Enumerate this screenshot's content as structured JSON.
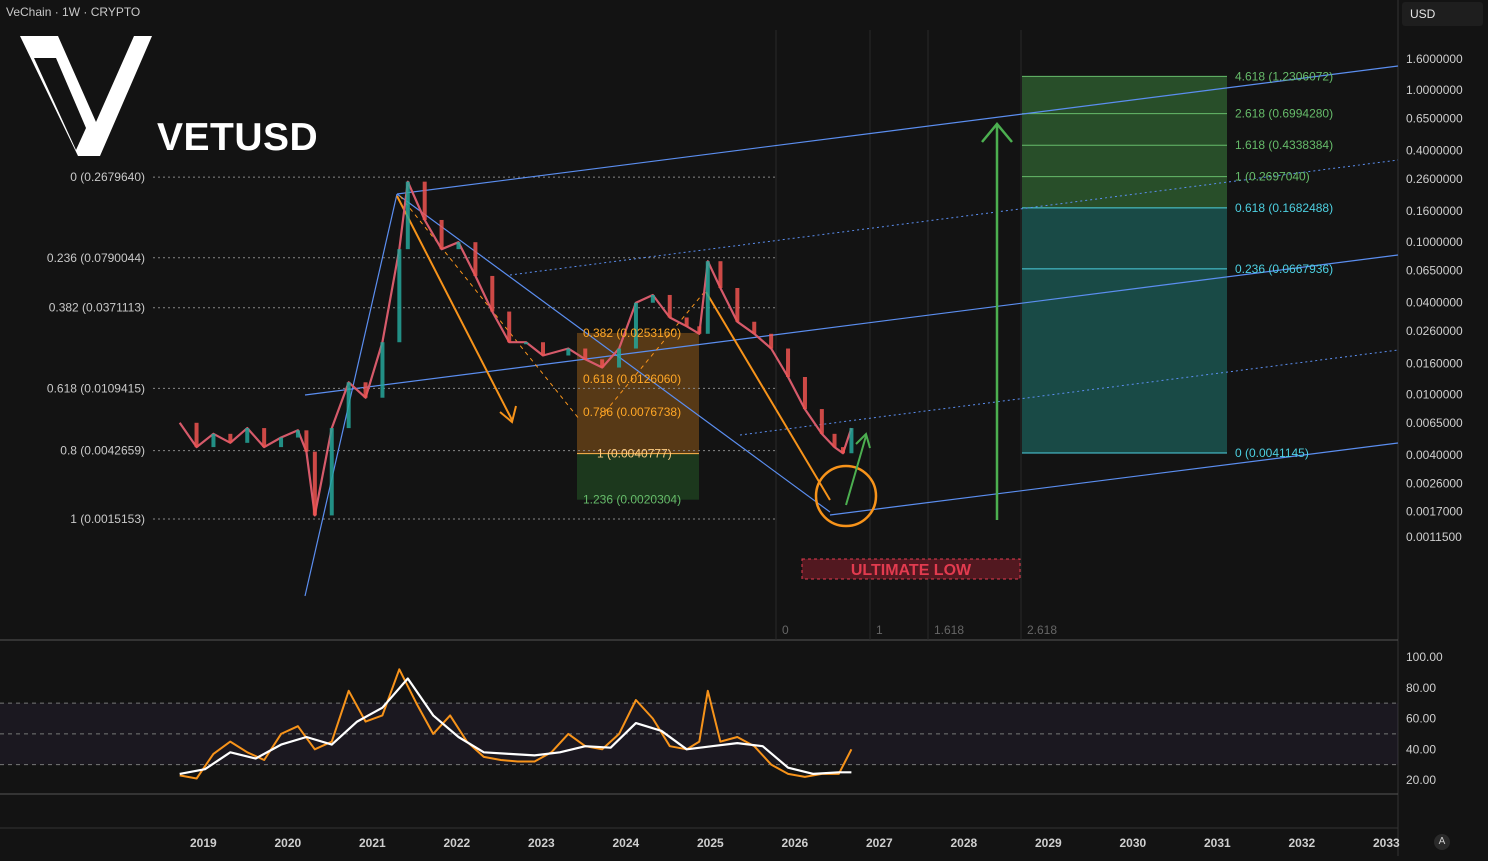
{
  "header": {
    "title": "VeChain · 1W · CRYPTO",
    "currency": "USD",
    "ticker": "VETUSD",
    "logo": "vechain-logo",
    "auto_button": "A"
  },
  "colors": {
    "background": "#131313",
    "bull": "#26a69a",
    "bear": "#ef5350",
    "orange": "#f7931a",
    "blue": "#5b8ef0",
    "green": "#4caf50",
    "cyan": "#4dd0e1",
    "red": "#e23b4f"
  },
  "price_axis": [
    "1.6000000",
    "1.0000000",
    "0.6500000",
    "0.4000000",
    "0.2600000",
    "0.1600000",
    "0.1000000",
    "0.0650000",
    "0.0400000",
    "0.0260000",
    "0.0160000",
    "0.0100000",
    "0.0065000",
    "0.0040000",
    "0.0026000",
    "0.0017000",
    "0.0011500"
  ],
  "rsi_axis": [
    "100.00",
    "80.00",
    "60.00",
    "40.00",
    "20.00"
  ],
  "time_axis": [
    "2019",
    "2020",
    "2021",
    "2022",
    "2023",
    "2024",
    "2025",
    "2026",
    "2027",
    "2028",
    "2029",
    "2030",
    "2031",
    "2032",
    "2033"
  ],
  "fib_retracement": [
    "0 (0.2679640)",
    "0.236 (0.0790044)",
    "0.382 (0.0371113)",
    "0.618 (0.0109415)",
    "0.8 (0.0042659)",
    "1 (0.0015153)"
  ],
  "fib_box_orange": [
    "0.382 (0.0253160)",
    "0.618 (0.0126060)",
    "0.786 (0.0076738)",
    "1 (0.0040777)",
    "1.236 (0.0020304)"
  ],
  "fib_extension": [
    "4.618 (1.2306072)",
    "2.618 (0.6994280)",
    "1.618 (0.4338384)",
    "1 (0.2697040)",
    "0.618 (0.1682488)",
    "0.236 (0.0667936)",
    "0 (0.0041145)"
  ],
  "time_fib": [
    "0",
    "1",
    "1.618",
    "2.618"
  ],
  "annotation": "ULTIMATE LOW",
  "chart_data": {
    "type": "line",
    "title": "VETUSD",
    "y_scale": "log",
    "ylim": [
      0.00105,
      2.0
    ],
    "x_range": [
      2018.55,
      2033.25
    ],
    "series": [
      {
        "x": [
          2018.7,
          2018.9,
          2019.1,
          2019.3,
          2019.5,
          2019.7,
          2019.9,
          2020.1,
          2020.2,
          2020.3,
          2020.5,
          2020.7,
          2020.9,
          2021.1,
          2021.3,
          2021.4,
          2021.6,
          2021.8,
          2022.0,
          2022.2,
          2022.4,
          2022.6,
          2022.8,
          2023.0,
          2023.3,
          2023.5,
          2023.7,
          2023.9,
          2024.1,
          2024.3,
          2024.5,
          2024.7,
          2024.85,
          2024.95,
          2025.1,
          2025.3,
          2025.5,
          2025.7,
          2025.9,
          2026.1,
          2026.3,
          2026.45,
          2026.55,
          2026.65
        ],
        "values": [
          0.0065,
          0.0045,
          0.0055,
          0.0048,
          0.006,
          0.0045,
          0.0052,
          0.0058,
          0.0042,
          0.0016,
          0.006,
          0.012,
          0.0095,
          0.022,
          0.09,
          0.25,
          0.14,
          0.09,
          0.1,
          0.06,
          0.035,
          0.022,
          0.022,
          0.018,
          0.02,
          0.017,
          0.015,
          0.02,
          0.04,
          0.045,
          0.032,
          0.028,
          0.025,
          0.075,
          0.05,
          0.03,
          0.025,
          0.02,
          0.013,
          0.008,
          0.0055,
          0.0045,
          0.0041,
          0.006
        ]
      }
    ],
    "rsi_series": [
      {
        "x": [
          2018.7,
          2018.9,
          2019.1,
          2019.3,
          2019.5,
          2019.7,
          2019.9,
          2020.1,
          2020.3,
          2020.5,
          2020.7,
          2020.9,
          2021.1,
          2021.3,
          2021.5,
          2021.7,
          2021.9,
          2022.1,
          2022.3,
          2022.5,
          2022.7,
          2022.9,
          2023.1,
          2023.3,
          2023.5,
          2023.7,
          2023.9,
          2024.1,
          2024.3,
          2024.5,
          2024.7,
          2024.85,
          2024.95,
          2025.1,
          2025.3,
          2025.5,
          2025.7,
          2025.9,
          2026.1,
          2026.3,
          2026.5,
          2026.65
        ],
        "values": [
          23,
          21,
          37,
          45,
          38,
          33,
          50,
          55,
          40,
          45,
          78,
          58,
          62,
          92,
          70,
          50,
          62,
          45,
          35,
          33,
          32,
          32,
          38,
          50,
          42,
          40,
          50,
          72,
          60,
          42,
          40,
          45,
          78,
          45,
          48,
          42,
          30,
          24,
          22,
          24,
          24,
          40
        ]
      },
      {
        "x": [
          2018.7,
          2019.0,
          2019.3,
          2019.6,
          2019.9,
          2020.2,
          2020.5,
          2020.8,
          2021.1,
          2021.4,
          2021.7,
          2022.0,
          2022.3,
          2022.6,
          2022.9,
          2023.2,
          2023.5,
          2023.8,
          2024.1,
          2024.4,
          2024.7,
          2025.0,
          2025.3,
          2025.6,
          2025.9,
          2026.2,
          2026.5,
          2026.65
        ],
        "values": [
          24,
          27,
          38,
          34,
          43,
          48,
          43,
          58,
          67,
          86,
          62,
          48,
          38,
          37,
          36,
          38,
          42,
          41,
          57,
          52,
          40,
          42,
          44,
          42,
          28,
          24,
          25,
          25
        ]
      }
    ]
  }
}
